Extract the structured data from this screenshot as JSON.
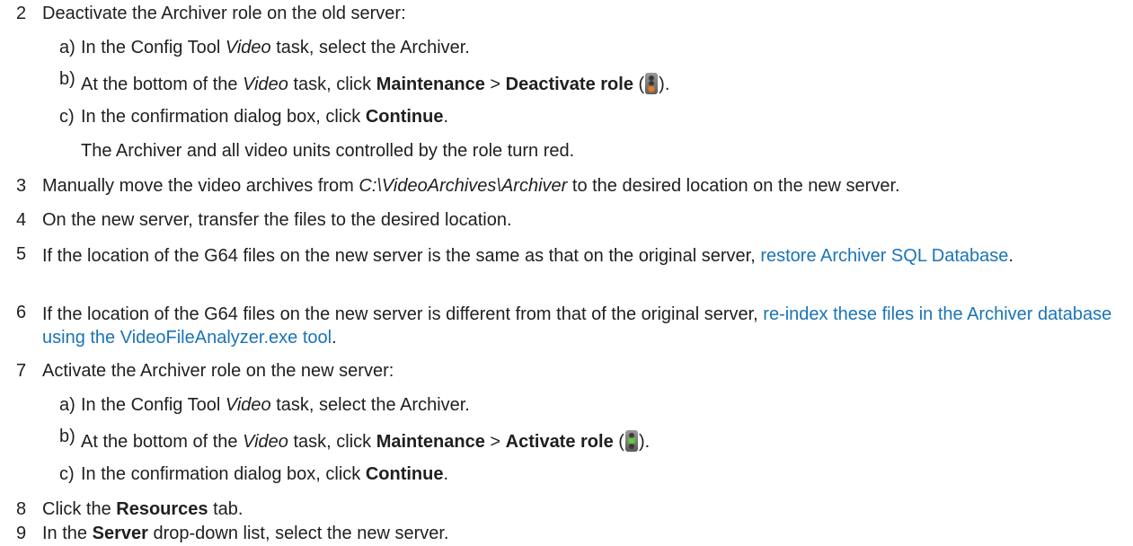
{
  "steps": [
    {
      "num": "2",
      "text": "Deactivate the Archiver role on the old server:"
    },
    {
      "num": "3",
      "text_a": "Manually move the video archives from ",
      "path": "C:\\VideoArchives\\Archiver",
      "text_b": " to the desired location on the new server."
    },
    {
      "num": "4",
      "text": "On the new server, transfer the files to the desired location."
    },
    {
      "num": "5",
      "text": "If the location of the G64 files on the new server is the same as that on the original server, ",
      "link": "restore Archiver SQL Database",
      "end": "."
    },
    {
      "num": "6",
      "text": "If the location of the G64 files on the new server is different from that of the original server, ",
      "link": "re-index these files in the Archiver database using the VideoFileAnalyzer.exe tool",
      "end": "."
    },
    {
      "num": "7",
      "text": "Activate the Archiver role on the new server:"
    },
    {
      "num": "8",
      "pre": "Click the ",
      "bold": "Resources",
      "post": " tab."
    },
    {
      "num": "9",
      "pre": "In the ",
      "bold": "Server",
      "post": " drop-down list, select the new server."
    }
  ],
  "step2_subs": [
    {
      "letter": "a)",
      "pre": "In the Config Tool ",
      "italic": "Video",
      "post": " task, select the Archiver."
    },
    {
      "letter": "b)",
      "pre": "At the bottom of the ",
      "italic": "Video",
      "mid": " task, click ",
      "bold1": "Maintenance",
      "sep": " > ",
      "bold2": "Deactivate role",
      "paren_open": " (",
      "icon": "traffic-light-orange-icon",
      "paren_close": ")."
    },
    {
      "letter": "c)",
      "pre": "In the confirmation dialog box, click ",
      "bold": "Continue",
      "post": "."
    }
  ],
  "step2_note": "The Archiver and all video units controlled by the role turn red.",
  "step7_subs": [
    {
      "letter": "a)",
      "pre": "In the Config Tool ",
      "italic": "Video",
      "post": " task, select the Archiver."
    },
    {
      "letter": "b)",
      "pre": "At the bottom of the ",
      "italic": "Video",
      "mid": " task, click ",
      "bold1": "Maintenance",
      "sep": " > ",
      "bold2": "Activate role",
      "paren_open": " (",
      "icon": "traffic-light-green-icon",
      "paren_close": ")."
    },
    {
      "letter": "c)",
      "pre": "In the confirmation dialog box, click ",
      "bold": "Continue",
      "post": "."
    }
  ],
  "colors": {
    "text": "#1f1f1f",
    "link": "#1a74b6",
    "orange_light": "#f07a20",
    "green_light": "#5cd12a"
  }
}
